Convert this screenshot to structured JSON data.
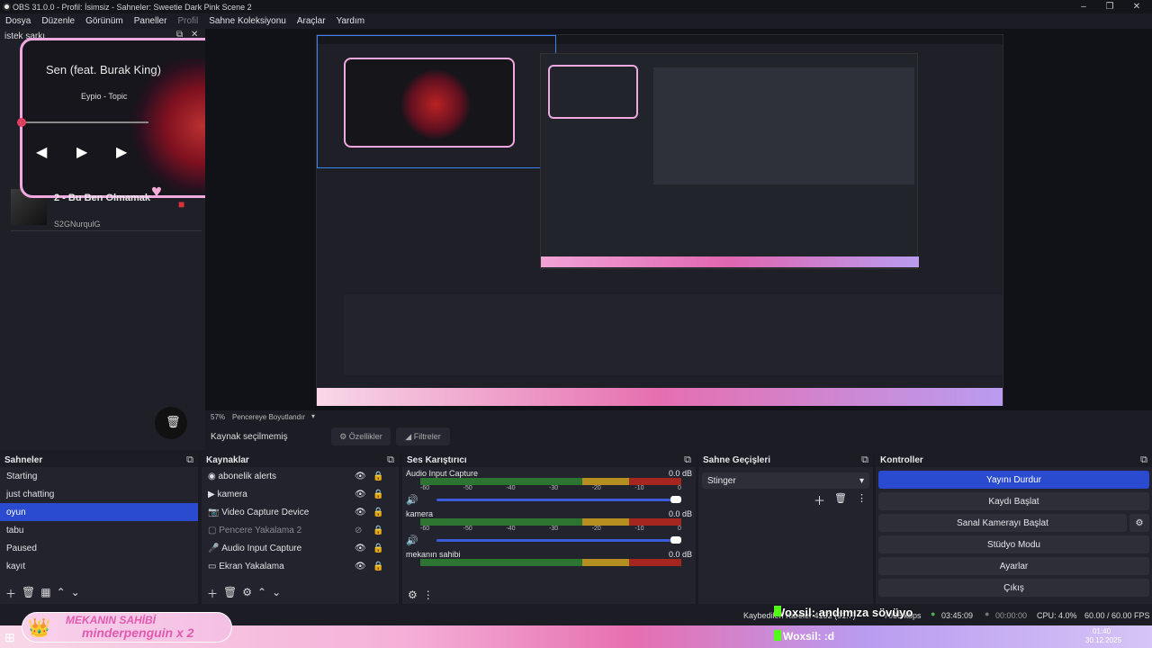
{
  "window": {
    "title": "OBS 31.0.0 - Profil: İsimsiz - Sahneler: Sweetie Dark Pink Scene 2"
  },
  "menu": [
    "Dosya",
    "Düzenle",
    "Görünüm",
    "Paneller",
    "Profil",
    "Sahne Koleksiyonu",
    "Araçlar",
    "Yardım"
  ],
  "song_dock": {
    "title": "istek şarkı",
    "song_title": "Sen (feat. Burak King)",
    "artist": "Eypio - Topic",
    "next_title": "2 - Bu Ben Olmamak",
    "next_user": "S2GNurqulG"
  },
  "preview": {
    "zoom": "57%",
    "fit_label": "Pencereye Boyutlandır",
    "no_source": "Kaynak seçilmemiş",
    "properties": "Özellikler",
    "filters": "Filtreler"
  },
  "scenes": {
    "title": "Sahneler",
    "items": [
      "Starting",
      "just chatting",
      "oyun",
      "tabu",
      "Paused",
      "kayıt"
    ],
    "selected": 2
  },
  "sources": {
    "title": "Kaynaklar",
    "items": [
      {
        "label": "abonelik alerts",
        "icon": "browser-icon"
      },
      {
        "label": "kamera",
        "icon": "media-icon"
      },
      {
        "label": "Video Capture Device",
        "icon": "camera-icon"
      },
      {
        "label": "Pencere Yakalama 2",
        "icon": "window-icon",
        "hidden": true
      },
      {
        "label": "Audio Input Capture",
        "icon": "mic-icon"
      },
      {
        "label": "Ekran Yakalama",
        "icon": "display-icon"
      }
    ]
  },
  "mixer": {
    "title": "Ses Karıştırıcı",
    "scale": [
      "-60",
      "-55",
      "-50",
      "-45",
      "-40",
      "-35",
      "-30",
      "-25",
      "-20",
      "-15",
      "-10",
      "-5",
      "0"
    ],
    "channels": [
      {
        "name": "Audio Input Capture",
        "db": "0.0 dB"
      },
      {
        "name": "kamera",
        "db": "0.0 dB"
      },
      {
        "name": "mekanın sahibi",
        "db": "0.0 dB"
      }
    ]
  },
  "transitions": {
    "title": "Sahne Geçişleri",
    "selected": "Stinger"
  },
  "controls": {
    "title": "Kontroller",
    "buttons": [
      "Yayını Durdur",
      "Kaydı Başlat",
      "Sanal Kamerayı Başlat",
      "Stüdyo Modu",
      "Ayarlar",
      "Çıkış"
    ]
  },
  "status": {
    "dropped": "Kaybedilen Kareler 4152 (91.7)",
    "bitrate": "7035 kbps",
    "stream_time": "03:45:09",
    "rec_time": "00:00:00",
    "cpu": "CPU: 4.0%",
    "fps": "60.00 / 60.00 FPS"
  },
  "overlay": {
    "kick_chat": "Woxsil: andımıza sövüyo",
    "kick_chat2": "Woxsil: :d",
    "banner_top": "MEKANIN SAHİBİ",
    "banner_name": "minderpenguin x 2"
  },
  "taskbar": {
    "time": "01:40",
    "date": "30.12.2025"
  },
  "colors": {
    "accent": "#2a4bd0",
    "pink_frame": "#f0a8e0",
    "bg": "#1e1f27"
  }
}
